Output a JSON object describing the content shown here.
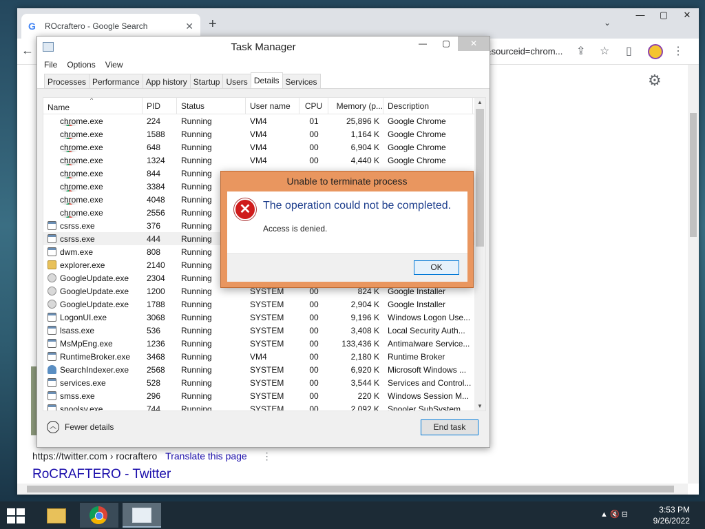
{
  "browser": {
    "tab_title": "ROcraftero - Google Search",
    "tab_close": "✕",
    "new_tab": "+",
    "tab_search": "⌄",
    "omnibox_tail": "&sourceid=chrom...",
    "window_controls": [
      "—",
      "▢",
      "✕"
    ],
    "icons": [
      "back-arrow-icon",
      "share-icon",
      "star-icon",
      "side-panel-icon",
      "profile-icon",
      "more-icon",
      "settings-gear-icon"
    ],
    "page": {
      "result_cite": "https://twitter.com › rocraftero",
      "translate": "Translate this page",
      "result_title": "RoCRAFTERO - Twitter"
    }
  },
  "task_manager": {
    "title": "Task Manager",
    "menu": [
      "File",
      "Options",
      "View"
    ],
    "tabs": [
      "Processes",
      "Performance",
      "App history",
      "Startup",
      "Users",
      "Details",
      "Services"
    ],
    "active_tab": "Details",
    "columns": [
      "Name",
      "PID",
      "Status",
      "User name",
      "CPU",
      "Memory (p...",
      "Description"
    ],
    "rows": [
      {
        "icon": "chrome",
        "name": "chrome.exe",
        "pid": "224",
        "status": "Running",
        "user": "VM4",
        "cpu": "01",
        "mem": "25,896 K",
        "desc": "Google Chrome"
      },
      {
        "icon": "chrome",
        "name": "chrome.exe",
        "pid": "1588",
        "status": "Running",
        "user": "VM4",
        "cpu": "00",
        "mem": "1,164 K",
        "desc": "Google Chrome"
      },
      {
        "icon": "chrome",
        "name": "chrome.exe",
        "pid": "648",
        "status": "Running",
        "user": "VM4",
        "cpu": "00",
        "mem": "6,904 K",
        "desc": "Google Chrome"
      },
      {
        "icon": "chrome",
        "name": "chrome.exe",
        "pid": "1324",
        "status": "Running",
        "user": "VM4",
        "cpu": "00",
        "mem": "4,440 K",
        "desc": "Google Chrome"
      },
      {
        "icon": "chrome",
        "name": "chrome.exe",
        "pid": "844",
        "status": "Running",
        "user": "",
        "cpu": "",
        "mem": "",
        "desc": ""
      },
      {
        "icon": "chrome",
        "name": "chrome.exe",
        "pid": "3384",
        "status": "Running",
        "user": "",
        "cpu": "",
        "mem": "",
        "desc": ""
      },
      {
        "icon": "chrome",
        "name": "chrome.exe",
        "pid": "4048",
        "status": "Running",
        "user": "",
        "cpu": "",
        "mem": "",
        "desc": ""
      },
      {
        "icon": "chrome",
        "name": "chrome.exe",
        "pid": "2556",
        "status": "Running",
        "user": "",
        "cpu": "",
        "mem": "",
        "desc": ""
      },
      {
        "icon": "app",
        "name": "csrss.exe",
        "pid": "376",
        "status": "Running",
        "user": "",
        "cpu": "",
        "mem": "",
        "desc": ""
      },
      {
        "icon": "app",
        "name": "csrss.exe",
        "pid": "444",
        "status": "Running",
        "user": "",
        "cpu": "",
        "mem": "",
        "desc": "",
        "selected": true
      },
      {
        "icon": "app",
        "name": "dwm.exe",
        "pid": "808",
        "status": "Running",
        "user": "",
        "cpu": "",
        "mem": "",
        "desc": ""
      },
      {
        "icon": "folder",
        "name": "explorer.exe",
        "pid": "2140",
        "status": "Running",
        "user": "",
        "cpu": "",
        "mem": "",
        "desc": ""
      },
      {
        "icon": "google",
        "name": "GoogleUpdate.exe",
        "pid": "2304",
        "status": "Running",
        "user": "",
        "cpu": "",
        "mem": "",
        "desc": ""
      },
      {
        "icon": "google",
        "name": "GoogleUpdate.exe",
        "pid": "1200",
        "status": "Running",
        "user": "SYSTEM",
        "cpu": "00",
        "mem": "824 K",
        "desc": "Google Installer"
      },
      {
        "icon": "google",
        "name": "GoogleUpdate.exe",
        "pid": "1788",
        "status": "Running",
        "user": "SYSTEM",
        "cpu": "00",
        "mem": "2,904 K",
        "desc": "Google Installer"
      },
      {
        "icon": "app",
        "name": "LogonUI.exe",
        "pid": "3068",
        "status": "Running",
        "user": "SYSTEM",
        "cpu": "00",
        "mem": "9,196 K",
        "desc": "Windows Logon Use..."
      },
      {
        "icon": "app",
        "name": "lsass.exe",
        "pid": "536",
        "status": "Running",
        "user": "SYSTEM",
        "cpu": "00",
        "mem": "3,408 K",
        "desc": "Local Security Auth..."
      },
      {
        "icon": "app",
        "name": "MsMpEng.exe",
        "pid": "1236",
        "status": "Running",
        "user": "SYSTEM",
        "cpu": "00",
        "mem": "133,436 K",
        "desc": "Antimalware Service..."
      },
      {
        "icon": "app",
        "name": "RuntimeBroker.exe",
        "pid": "3468",
        "status": "Running",
        "user": "VM4",
        "cpu": "00",
        "mem": "2,180 K",
        "desc": "Runtime Broker"
      },
      {
        "icon": "person",
        "name": "SearchIndexer.exe",
        "pid": "2568",
        "status": "Running",
        "user": "SYSTEM",
        "cpu": "00",
        "mem": "6,920 K",
        "desc": "Microsoft Windows ..."
      },
      {
        "icon": "app",
        "name": "services.exe",
        "pid": "528",
        "status": "Running",
        "user": "SYSTEM",
        "cpu": "00",
        "mem": "3,544 K",
        "desc": "Services and Control..."
      },
      {
        "icon": "app",
        "name": "smss.exe",
        "pid": "296",
        "status": "Running",
        "user": "SYSTEM",
        "cpu": "00",
        "mem": "220 K",
        "desc": "Windows Session M..."
      },
      {
        "icon": "app",
        "name": "spoolsv.exe",
        "pid": "744",
        "status": "Running",
        "user": "SYSTEM",
        "cpu": "00",
        "mem": "2,092 K",
        "desc": "Spooler SubSystem ..."
      }
    ],
    "fewer_details": "Fewer details",
    "end_task": "End task"
  },
  "dialog": {
    "title": "Unable to terminate process",
    "message": "The operation could not be completed.",
    "detail": "Access is denied.",
    "ok": "OK",
    "icon": "error-icon"
  },
  "taskbar": {
    "time": "3:53 PM",
    "date": "9/26/2022",
    "apps": [
      "file-explorer-icon",
      "chrome-icon",
      "task-manager-icon"
    ],
    "tray": "▲  🔇  ⊟"
  }
}
